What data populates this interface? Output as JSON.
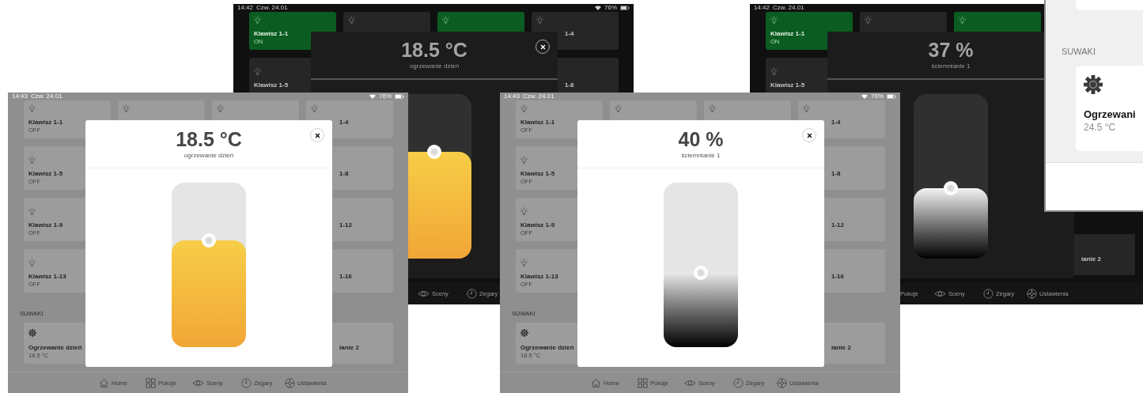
{
  "screens": [
    {
      "kind": "dark",
      "status": {
        "time": "14:42",
        "date": "Czw. 24.01",
        "battery": "76%"
      },
      "switches": [
        {
          "kind": "switch",
          "on": true,
          "title": "Klawisz 1-1",
          "state": "ON"
        },
        {
          "kind": "switch",
          "on": false
        },
        {
          "kind": "switch",
          "on": true
        },
        {
          "kind": "switch",
          "on": false,
          "title": "1-4"
        },
        {
          "kind": "switch",
          "on": false,
          "title": "Klawisz 1-5"
        },
        {
          "kind": "covered"
        },
        {
          "kind": "covered"
        },
        {
          "kind": "switch",
          "on": false,
          "title": "1-8"
        }
      ],
      "modal": {
        "value": "18.5 °C",
        "label": "ogrzewanie dzień",
        "slider": {
          "kind": "heat",
          "level": 0.65
        }
      },
      "nav": [
        {
          "kind": "covered"
        },
        {
          "kind": "covered"
        },
        {
          "kind": "item",
          "label": "Sceny"
        },
        {
          "kind": "item",
          "label": "Zegary"
        },
        {
          "kind": "covered"
        }
      ]
    },
    {
      "kind": "dark",
      "status": {
        "time": "14:42",
        "date": "Czw. 24.01"
      },
      "switches": [
        {
          "kind": "switch",
          "on": true,
          "title": "Klawisz 1-1",
          "state": "ON"
        },
        {
          "kind": "switch",
          "on": false
        },
        {
          "kind": "switch",
          "on": true
        },
        {
          "kind": "covered"
        },
        {
          "kind": "switch",
          "on": false,
          "title": "Klawisz 1-5"
        }
      ],
      "sliders": [
        {
          "kind": "covered"
        },
        {
          "kind": "covered"
        },
        {
          "kind": "covered"
        },
        {
          "kind": "slider",
          "title": "ianie 2"
        }
      ],
      "modal": {
        "value": "37 %",
        "label": "ściemnianie 1",
        "slider": {
          "kind": "dim",
          "level": 0.43
        }
      },
      "nav": [
        {
          "kind": "covered"
        },
        {
          "kind": "label",
          "label": "Pokoje"
        },
        {
          "kind": "item",
          "label": "Sceny"
        },
        {
          "kind": "item",
          "label": "Zegary"
        },
        {
          "kind": "item",
          "label": "Ustawienia"
        }
      ]
    },
    {
      "kind": "light",
      "status": {
        "time": "14:43",
        "date": "Czw. 24.01",
        "battery": "76%"
      },
      "switches": [
        {
          "kind": "switch",
          "on": false,
          "title": "Klawisz 1-1",
          "state": "OFF"
        },
        {
          "kind": "switch",
          "on": false
        },
        {
          "kind": "switch",
          "on": false
        },
        {
          "kind": "switch",
          "on": false,
          "title": "1-4"
        },
        {
          "kind": "switch",
          "on": false,
          "title": "Klawisz 1-5",
          "state": "OFF"
        },
        {
          "kind": "covered"
        },
        {
          "kind": "covered"
        },
        {
          "kind": "switch",
          "on": false,
          "title": "1-8"
        },
        {
          "kind": "switch",
          "on": false,
          "title": "Klawisz 1-9",
          "state": "OFF"
        },
        {
          "kind": "covered"
        },
        {
          "kind": "covered"
        },
        {
          "kind": "switch",
          "on": false,
          "title": "1-12"
        },
        {
          "kind": "switch",
          "on": false,
          "title": "Klawisz 1-13",
          "state": "OFF"
        },
        {
          "kind": "covered"
        },
        {
          "kind": "covered"
        },
        {
          "kind": "switch",
          "on": false,
          "title": "1-16"
        }
      ],
      "section": "SUWAKI",
      "sliders": [
        {
          "kind": "slider",
          "title": "Ogrzewanie dzień",
          "state": "18.5 °C"
        },
        {
          "kind": "covered"
        },
        {
          "kind": "covered"
        },
        {
          "kind": "slider",
          "title": "ianie 2"
        }
      ],
      "modal": {
        "value": "18.5 °C",
        "label": "ogrzewanie dzień",
        "slider": {
          "kind": "heat",
          "level": 0.65
        }
      },
      "nav": [
        {
          "kind": "item",
          "label": "Home"
        },
        {
          "kind": "item",
          "label": "Pokoje"
        },
        {
          "kind": "item",
          "label": "Sceny"
        },
        {
          "kind": "item",
          "label": "Zegary"
        },
        {
          "kind": "item",
          "label": "Ustawienia"
        }
      ]
    },
    {
      "kind": "light",
      "status": {
        "time": "14:43",
        "date": "Czw. 24.01",
        "battery": "76%"
      },
      "switches": [
        {
          "kind": "switch",
          "on": false,
          "title": "Klawisz 1-1",
          "state": "OFF"
        },
        {
          "kind": "switch",
          "on": false
        },
        {
          "kind": "switch",
          "on": false
        },
        {
          "kind": "switch",
          "on": false,
          "title": "1-4"
        },
        {
          "kind": "switch",
          "on": false,
          "title": "Klawisz 1-5",
          "state": "OFF"
        },
        {
          "kind": "covered"
        },
        {
          "kind": "covered"
        },
        {
          "kind": "switch",
          "on": false,
          "title": "1-8"
        },
        {
          "kind": "switch",
          "on": false,
          "title": "Klawisz 1-9",
          "state": "OFF"
        },
        {
          "kind": "covered"
        },
        {
          "kind": "covered"
        },
        {
          "kind": "switch",
          "on": false,
          "title": "1-12"
        },
        {
          "kind": "switch",
          "on": false,
          "title": "Klawisz 1-13",
          "state": "OFF"
        },
        {
          "kind": "covered"
        },
        {
          "kind": "covered"
        },
        {
          "kind": "switch",
          "on": false,
          "title": "1-16"
        }
      ],
      "section": "SUWAKI",
      "sliders": [
        {
          "kind": "slider",
          "title": "Ogrzewanie dzień",
          "state": "18.5 °C"
        },
        {
          "kind": "covered"
        },
        {
          "kind": "covered"
        },
        {
          "kind": "slider",
          "title": "ianie 2"
        }
      ],
      "modal": {
        "value": "40 %",
        "label": "ściemnianie 1",
        "slider": {
          "kind": "dim",
          "level": 0.45
        }
      },
      "nav": [
        {
          "kind": "item",
          "label": "Home"
        },
        {
          "kind": "item",
          "label": "Pokoje"
        },
        {
          "kind": "item",
          "label": "Sceny"
        },
        {
          "kind": "item",
          "label": "Zegary"
        },
        {
          "kind": "item",
          "label": "Ustawienia"
        }
      ]
    }
  ],
  "panel": {
    "section": "SUWAKI",
    "card": {
      "title": "Ogrzewani",
      "value": "24.5 °C"
    }
  }
}
